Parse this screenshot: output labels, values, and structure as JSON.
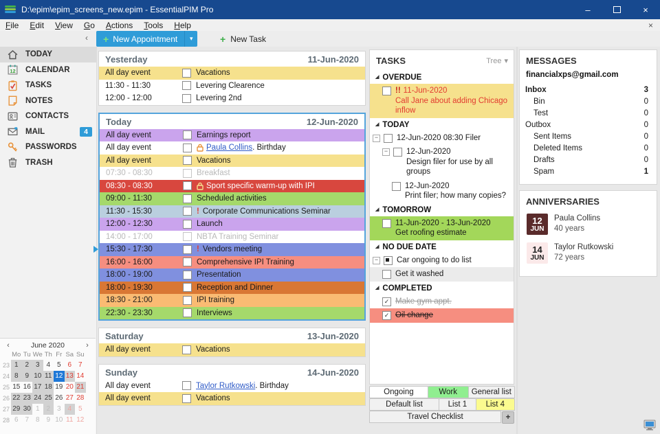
{
  "window": {
    "title": "D:\\epim\\epim_screens_new.epim - EssentialPIM Pro"
  },
  "icons": {
    "dropdown_arrow": "▾",
    "section_expanded": "◢",
    "expander_collapse": "−",
    "checkmark": "✓",
    "window_min": "–",
    "window_close": "×",
    "menu_close": "×"
  },
  "menu": {
    "items": [
      "File",
      "Edit",
      "View",
      "Go",
      "Actions",
      "Tools",
      "Help"
    ],
    "close_label": "×"
  },
  "toolbar": {
    "collapse": "‹",
    "new_appointment": "New Appointment",
    "new_task": "New Task",
    "appt_dropdown": "▾",
    "plus": "+"
  },
  "sidebar": {
    "items": [
      {
        "label": "TODAY",
        "icon": "home-icon",
        "selected": true
      },
      {
        "label": "CALENDAR",
        "icon": "calendar-icon"
      },
      {
        "label": "TASKS",
        "icon": "tasks-icon"
      },
      {
        "label": "NOTES",
        "icon": "notes-icon"
      },
      {
        "label": "CONTACTS",
        "icon": "contacts-icon"
      },
      {
        "label": "MAIL",
        "icon": "mail-icon",
        "badge": "4"
      },
      {
        "label": "PASSWORDS",
        "icon": "key-icon"
      },
      {
        "label": "TRASH",
        "icon": "trash-icon"
      }
    ]
  },
  "mini_calendar": {
    "month_label": "June  2020",
    "prev": "‹",
    "next": "›",
    "day_names": [
      "Mo",
      "Tu",
      "We",
      "Th",
      "Fr",
      "Sa",
      "Su"
    ],
    "weeks": [
      {
        "num": "23",
        "days": [
          {
            "d": "1",
            "s": "busy"
          },
          {
            "d": "2",
            "s": "busy"
          },
          {
            "d": "3",
            "s": "busy"
          },
          {
            "d": "4",
            "s": ""
          },
          {
            "d": "5",
            "s": ""
          },
          {
            "d": "6",
            "s": "wk"
          },
          {
            "d": "7",
            "s": "wk"
          }
        ]
      },
      {
        "num": "24",
        "days": [
          {
            "d": "8",
            "s": "busy"
          },
          {
            "d": "9",
            "s": "busy"
          },
          {
            "d": "10",
            "s": "busy"
          },
          {
            "d": "11",
            "s": "busy"
          },
          {
            "d": "12",
            "s": "sel"
          },
          {
            "d": "13",
            "s": "wk busy"
          },
          {
            "d": "14",
            "s": "wk"
          }
        ]
      },
      {
        "num": "25",
        "days": [
          {
            "d": "15",
            "s": ""
          },
          {
            "d": "16",
            "s": ""
          },
          {
            "d": "17",
            "s": "busy"
          },
          {
            "d": "18",
            "s": "busy"
          },
          {
            "d": "19",
            "s": ""
          },
          {
            "d": "20",
            "s": "wk"
          },
          {
            "d": "21",
            "s": "wk busy"
          }
        ]
      },
      {
        "num": "26",
        "days": [
          {
            "d": "22",
            "s": "busy"
          },
          {
            "d": "23",
            "s": "busy"
          },
          {
            "d": "24",
            "s": "busy"
          },
          {
            "d": "25",
            "s": "busy"
          },
          {
            "d": "26",
            "s": ""
          },
          {
            "d": "27",
            "s": "wk"
          },
          {
            "d": "28",
            "s": "wk"
          }
        ]
      },
      {
        "num": "27",
        "days": [
          {
            "d": "29",
            "s": "busy"
          },
          {
            "d": "30",
            "s": "busy"
          },
          {
            "d": "1",
            "s": "out"
          },
          {
            "d": "2",
            "s": "out busy"
          },
          {
            "d": "3",
            "s": "out"
          },
          {
            "d": "4",
            "s": "outwk busy"
          },
          {
            "d": "5",
            "s": "outwk"
          }
        ]
      },
      {
        "num": "28",
        "days": [
          {
            "d": "6",
            "s": "out"
          },
          {
            "d": "7",
            "s": "out"
          },
          {
            "d": "8",
            "s": "out"
          },
          {
            "d": "9",
            "s": "out"
          },
          {
            "d": "10",
            "s": "out"
          },
          {
            "d": "11",
            "s": "outwk"
          },
          {
            "d": "12",
            "s": "outwk"
          }
        ]
      }
    ]
  },
  "calendar": {
    "day_cards": [
      {
        "name": "Yesterday",
        "date": "11-Jun-2020",
        "selected": false,
        "events": [
          {
            "time": "All day event",
            "title": "Vacations",
            "bg": "#F6E18D"
          },
          {
            "time": "11:30 - 11:30",
            "title": "Levering Clearence",
            "bg": ""
          },
          {
            "time": "12:00 - 12:00",
            "title": "Levering 2nd",
            "bg": ""
          }
        ]
      },
      {
        "name": "Today",
        "date": "12-Jun-2020",
        "selected": true,
        "events": [
          {
            "time": "All day event",
            "title": "Earnings report",
            "bg": "#CAA4ED"
          },
          {
            "time": "All day event",
            "link": "Paula Collins",
            "rest": ". Birthday",
            "lock": "#E8923A",
            "bg": ""
          },
          {
            "time": "All day event",
            "title": "Vacations",
            "bg": "#F6E18D"
          },
          {
            "time": "07:30 - 08:30",
            "title": "Breakfast",
            "bg": "",
            "tentative": true
          },
          {
            "time": "08:30 - 08:30",
            "title": "Sport specific warm-up with IPI",
            "bg": "#D8473E",
            "white": true,
            "lock": "#F6E18D"
          },
          {
            "time": "09:00 - 11:30",
            "title": "Scheduled activities",
            "bg": "#A5D96B"
          },
          {
            "time": "11:30 - 15:30",
            "title": "Corporate Communications Seminar",
            "bg": "#BACFDF",
            "priority": "!"
          },
          {
            "time": "12:00 - 12:30",
            "title": "Launch",
            "bg": "#CAA4ED"
          },
          {
            "time": "14:00 - 17:00",
            "title": "NBTA Training Seminar",
            "bg": "",
            "tentative": true
          },
          {
            "time": "15:30 - 17:30",
            "title": "Vendors meeting",
            "bg": "#8090DF",
            "priority": "!",
            "current": true
          },
          {
            "time": "16:00 - 16:00",
            "title": "Comprehensive IPI Training",
            "bg": "#F68E80"
          },
          {
            "time": "18:00 - 19:00",
            "title": "Presentation",
            "bg": "#8090DF"
          },
          {
            "time": "18:00 - 19:30",
            "title": "Reception and Dinner",
            "bg": "#D97734"
          },
          {
            "time": "18:30 - 21:00",
            "title": "IPI training",
            "bg": "#FABB73"
          },
          {
            "time": "22:30 - 23:30",
            "title": "Interviews",
            "bg": "#A5D96B"
          }
        ]
      },
      {
        "name": "Saturday",
        "date": "13-Jun-2020",
        "selected": false,
        "events": [
          {
            "time": "All day event",
            "title": "Vacations",
            "bg": "#F6E18D"
          }
        ]
      },
      {
        "name": "Sunday",
        "date": "14-Jun-2020",
        "selected": false,
        "events": [
          {
            "time": "All day event",
            "link": "Taylor Rutkowski",
            "rest": ". Birthday",
            "bg": ""
          },
          {
            "time": "All day event",
            "title": "Vacations",
            "bg": "#F6E18D"
          }
        ]
      }
    ]
  },
  "tasks": {
    "header": "TASKS",
    "view_label": "Tree",
    "sections": [
      {
        "title": "OVERDUE",
        "items": [
          {
            "pad": 1,
            "check": "empty",
            "bg": "#F6E18D",
            "color": "#E23B30",
            "prefix": "!!",
            "line1": "11-Jun-2020",
            "line2": "Call Jane about adding Chicago inflow"
          }
        ]
      },
      {
        "title": "TODAY",
        "items": [
          {
            "pad": 0,
            "expander": true,
            "check": "empty",
            "line1": "12-Jun-2020 08:30 Filer"
          },
          {
            "pad": 1,
            "expander": true,
            "check": "empty",
            "line1": "12-Jun-2020",
            "line2": "Design filer for use by all groups"
          },
          {
            "pad": 2,
            "check": "empty",
            "line1": "12-Jun-2020",
            "line2": "Print filer; how many copies?"
          }
        ]
      },
      {
        "title": "TOMORROW",
        "items": [
          {
            "pad": 1,
            "check": "empty",
            "bg": "#A3D75A",
            "line1": "11-Jun-2020 - 13-Jun-2020",
            "line2": "Get roofing estimate"
          }
        ]
      },
      {
        "title": "NO DUE DATE",
        "items": [
          {
            "pad": 0,
            "expander": true,
            "check": "partial",
            "line1": "Car ongoing to do list"
          },
          {
            "pad": 1,
            "check": "empty",
            "bg": "#EBEBEB",
            "line1": "Get it washed"
          }
        ]
      },
      {
        "title": "COMPLETED",
        "items": [
          {
            "pad": 1,
            "check": "checked",
            "strike": true,
            "color": "#9A9A9A",
            "line1": "Make gym appt."
          },
          {
            "pad": 1,
            "check": "checked",
            "strike": true,
            "bg": "#F68E80",
            "line1": "Oil change"
          }
        ]
      }
    ],
    "tabs": {
      "rows": [
        [
          {
            "label": "Ongoing",
            "bg": "#FFFFFF",
            "flex": 1.45,
            "active": true
          },
          {
            "label": "Work",
            "bg": "#90EE90",
            "flex": 1
          },
          {
            "label": "General list",
            "bg": "#F1F1F1",
            "flex": 1.15
          }
        ],
        [
          {
            "label": "Default list",
            "bg": "#F1F1F1",
            "flex": 1.9
          },
          {
            "label": "List 1",
            "bg": "#F1F1F1",
            "flex": 1
          },
          {
            "label": "List 4",
            "bg": "#FBFB8F",
            "flex": 1.05
          }
        ],
        [
          {
            "label": "Travel Checklist",
            "bg": "#F1F1F1",
            "flex": 1
          }
        ]
      ],
      "add_label": "+"
    }
  },
  "messages": {
    "header": "MESSAGES",
    "account": "financialxps@gmail.com",
    "folders": [
      {
        "label": "Inbox",
        "count": "3",
        "indent": 0,
        "bold": true
      },
      {
        "label": "Bin",
        "count": "0",
        "indent": 1
      },
      {
        "label": "Test",
        "count": "0",
        "indent": 1
      },
      {
        "label": "Outbox",
        "count": "0",
        "indent": 0
      },
      {
        "label": "Sent Items",
        "count": "0",
        "indent": 1
      },
      {
        "label": "Deleted Items",
        "count": "0",
        "indent": 1
      },
      {
        "label": "Drafts",
        "count": "0",
        "indent": 1
      },
      {
        "label": "Spam",
        "count": "1",
        "indent": 1
      }
    ]
  },
  "anniversaries": {
    "header": "ANNIVERSARIES",
    "entries": [
      {
        "day": "12",
        "month": "JUN",
        "name": "Paula Collins",
        "years": "40 years",
        "badge_bg": "#5A2B2B",
        "badge_fg": "#FFFFFF"
      },
      {
        "day": "14",
        "month": "JUN",
        "name": "Taylor Rutkowski",
        "years": "72 years",
        "badge_bg": "#FBE9E9",
        "badge_fg": "#222222"
      }
    ]
  }
}
